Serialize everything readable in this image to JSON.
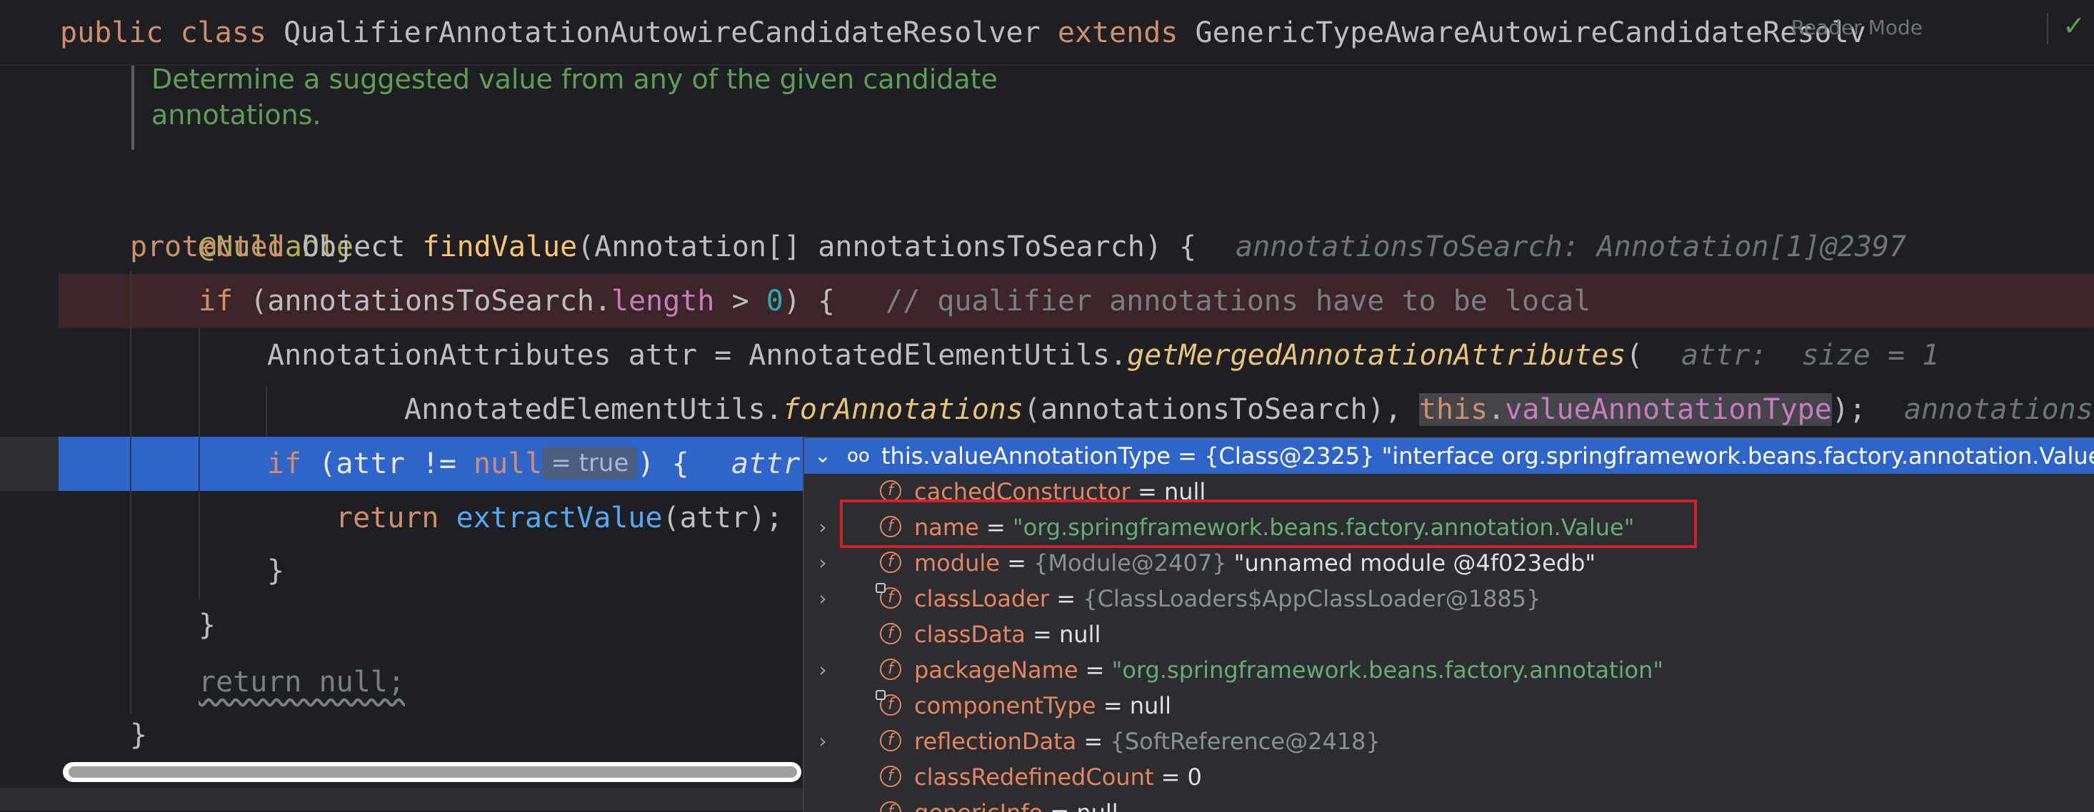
{
  "sticky_header": {
    "kw_public": "public",
    "kw_class": "class",
    "class_name": "QualifierAnnotationAutowireCandidateResolver",
    "kw_extends": "extends",
    "super_name": "GenericTypeAwareAutowireCandidateResolv",
    "reader_mode": "Reader Mode",
    "check_icon": "✓"
  },
  "doc_comment": {
    "line1": "Determine a suggested value from any of the given candidate",
    "line2": "annotations."
  },
  "code": {
    "annotation": "@Nullable",
    "l2_protected": "protected",
    "l2_type": " Object ",
    "l2_method": "findValue",
    "l2_params": "(Annotation[] annotationsToSearch) {",
    "l2_hint": "annotationsToSearch: Annotation[1]@2397",
    "l3_if": "if",
    "l3_a": " (annotationsToSearch.",
    "l3_length": "length",
    "l3_b": " > ",
    "l3_zero": "0",
    "l3_c": ") {",
    "l3_comment": "// qualifier annotations have to be local",
    "l4_a": "AnnotationAttributes attr = AnnotatedElementUtils.",
    "l4_method": "getMergedAnnotationAttributes",
    "l4_b": "(",
    "l4_hint": "attr:  size = 1",
    "l5_a": "AnnotatedElementUtils.",
    "l5_method": "forAnnotations",
    "l5_b": "(annotationsToSearch), ",
    "l5_this": "this",
    "l5_dot": ".",
    "l5_field": "valueAnnotationType",
    "l5_c": ");",
    "l5_hint": "annotations",
    "l6_if": "if",
    "l6_a": " (attr != ",
    "l6_null": "null",
    "l6_inlay": "= true",
    "l6_b": ") {",
    "l6_hint": "attr",
    "l7_return": "return",
    "l7_method": "extractValue",
    "l7_a": "(attr);",
    "l8_brace": "}",
    "l9_brace": "}",
    "l10_return": "return null;",
    "l11_brace": "}"
  },
  "debug_popup": {
    "header": {
      "watch_icon": "oo",
      "text": "this.valueAnnotationType = {Class@2325} \"interface org.springframework.beans.factory.annotation.Value\"... Navi"
    },
    "rows": [
      {
        "expandable": false,
        "locked": false,
        "name": "cachedConstructor",
        "eq": " = ",
        "ref": "",
        "value": "null",
        "value_kind": "null"
      },
      {
        "expandable": true,
        "locked": false,
        "name": "name",
        "eq": " = ",
        "ref": "",
        "value": "\"org.springframework.beans.factory.annotation.Value\"",
        "value_kind": "str"
      },
      {
        "expandable": true,
        "locked": false,
        "name": "module",
        "eq": " = ",
        "ref": "{Module@2407}",
        "value": " \"unnamed module @4f023edb\"",
        "value_kind": "plain"
      },
      {
        "expandable": true,
        "locked": true,
        "name": "classLoader",
        "eq": " = ",
        "ref": "{ClassLoaders$AppClassLoader@1885}",
        "value": "",
        "value_kind": "plain"
      },
      {
        "expandable": false,
        "locked": false,
        "name": "classData",
        "eq": " = ",
        "ref": "",
        "value": "null",
        "value_kind": "null"
      },
      {
        "expandable": true,
        "locked": false,
        "name": "packageName",
        "eq": " = ",
        "ref": "",
        "value": "\"org.springframework.beans.factory.annotation\"",
        "value_kind": "str"
      },
      {
        "expandable": false,
        "locked": true,
        "name": "componentType",
        "eq": " = ",
        "ref": "",
        "value": "null",
        "value_kind": "null"
      },
      {
        "expandable": true,
        "locked": false,
        "name": "reflectionData",
        "eq": " = ",
        "ref": "{SoftReference@2418}",
        "value": "",
        "value_kind": "plain"
      },
      {
        "expandable": false,
        "locked": false,
        "name": "classRedefinedCount",
        "eq": " = ",
        "ref": "",
        "value": "0",
        "value_kind": "null"
      },
      {
        "expandable": false,
        "locked": false,
        "name": "genericInfo",
        "eq": " = ",
        "ref": "",
        "value": "null",
        "value_kind": "null"
      }
    ]
  },
  "icons": {
    "field_icon": "f",
    "chevron_down": "⌄",
    "chevron_right": "›"
  },
  "colors": {
    "editor_bg": "#1e1f22",
    "breakpoint_line": "#3c2527",
    "execution_line": "#2f65ca",
    "highlight_box": "#d22128"
  }
}
